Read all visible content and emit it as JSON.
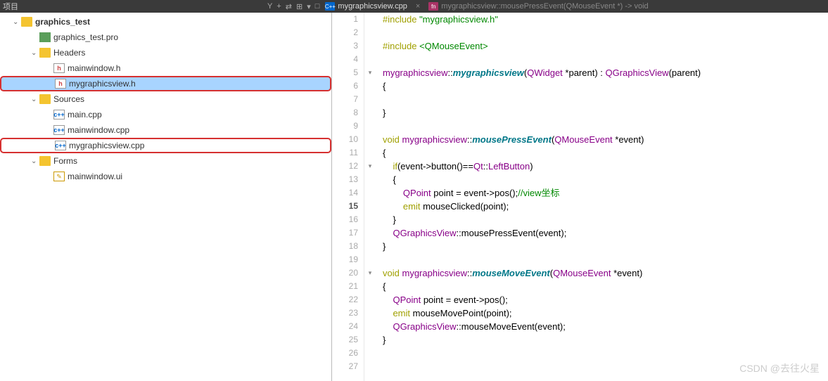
{
  "topbar": {
    "title_left": "项目",
    "icons": [
      "Y",
      "+",
      "⇄",
      "⊞",
      "▾",
      "□"
    ]
  },
  "tabs": {
    "active": {
      "icon": "C++",
      "label": "mygraphicsview.cpp"
    },
    "crumb": {
      "icon": "fn",
      "label": "mygraphicsview::mousePressEvent(QMouseEvent *) -> void"
    },
    "close": "×"
  },
  "tree": {
    "root": "graphics_test",
    "items": [
      {
        "label": "graphics_test.pro",
        "type": "pro"
      },
      {
        "label": "Headers",
        "type": "folder",
        "expanded": true,
        "children": [
          {
            "label": "mainwindow.h",
            "type": "h"
          },
          {
            "label": "mygraphicsview.h",
            "type": "h",
            "selected": true,
            "highlight": true
          }
        ]
      },
      {
        "label": "Sources",
        "type": "folder",
        "expanded": true,
        "children": [
          {
            "label": "main.cpp",
            "type": "cpp"
          },
          {
            "label": "mainwindow.cpp",
            "type": "cpp"
          },
          {
            "label": "mygraphicsview.cpp",
            "type": "cpp",
            "highlight": true
          }
        ]
      },
      {
        "label": "Forms",
        "type": "folder",
        "expanded": true,
        "children": [
          {
            "label": "mainwindow.ui",
            "type": "ui"
          }
        ]
      }
    ]
  },
  "editor": {
    "current_line": 15,
    "fold_markers": [
      5,
      12,
      20
    ],
    "lines": [
      {
        "n": 1,
        "html": "<span class='kw'>#include</span> <span class='str'>\"mygraphicsview.h\"</span>"
      },
      {
        "n": 2,
        "html": ""
      },
      {
        "n": 3,
        "html": "<span class='kw'>#include</span> <span class='inc'>&lt;QMouseEvent&gt;</span>"
      },
      {
        "n": 4,
        "html": ""
      },
      {
        "n": 5,
        "html": "<span class='type'>mygraphicsview</span>::<span class='func'>mygraphicsview</span>(<span class='type'>QWidget</span> *parent) : <span class='type'>QGraphicsView</span>(parent)"
      },
      {
        "n": 6,
        "html": "{"
      },
      {
        "n": 7,
        "html": ""
      },
      {
        "n": 8,
        "html": "}"
      },
      {
        "n": 9,
        "html": ""
      },
      {
        "n": 10,
        "html": "<span class='kw'>void</span> <span class='type'>mygraphicsview</span>::<span class='func'>mousePressEvent</span>(<span class='type'>QMouseEvent</span> *event)"
      },
      {
        "n": 11,
        "html": "{"
      },
      {
        "n": 12,
        "html": "    <span class='kw'>if</span>(event-&gt;button()==<span class='ns'>Qt</span>::<span class='enumv'>LeftButton</span>)"
      },
      {
        "n": 13,
        "html": "    {"
      },
      {
        "n": 14,
        "html": "        <span class='type'>QPoint</span> point = event-&gt;pos();<span class='cmt'>//view坐标</span>"
      },
      {
        "n": 15,
        "html": "        <span class='kw'>emit</span> mouseClicked(point);"
      },
      {
        "n": 16,
        "html": "    }"
      },
      {
        "n": 17,
        "html": "    <span class='type'>QGraphicsView</span>::mousePressEvent(event);"
      },
      {
        "n": 18,
        "html": "}"
      },
      {
        "n": 19,
        "html": ""
      },
      {
        "n": 20,
        "html": "<span class='kw'>void</span> <span class='type'>mygraphicsview</span>::<span class='func'>mouseMoveEvent</span>(<span class='type'>QMouseEvent</span> *event)"
      },
      {
        "n": 21,
        "html": "{"
      },
      {
        "n": 22,
        "html": "    <span class='type'>QPoint</span> point = event-&gt;pos();"
      },
      {
        "n": 23,
        "html": "    <span class='kw'>emit</span> mouseMovePoint(point);"
      },
      {
        "n": 24,
        "html": "    <span class='type'>QGraphicsView</span>::mouseMoveEvent(event);"
      },
      {
        "n": 25,
        "html": "}"
      },
      {
        "n": 26,
        "html": ""
      },
      {
        "n": 27,
        "html": ""
      }
    ]
  },
  "watermark": "CSDN @去往火星"
}
